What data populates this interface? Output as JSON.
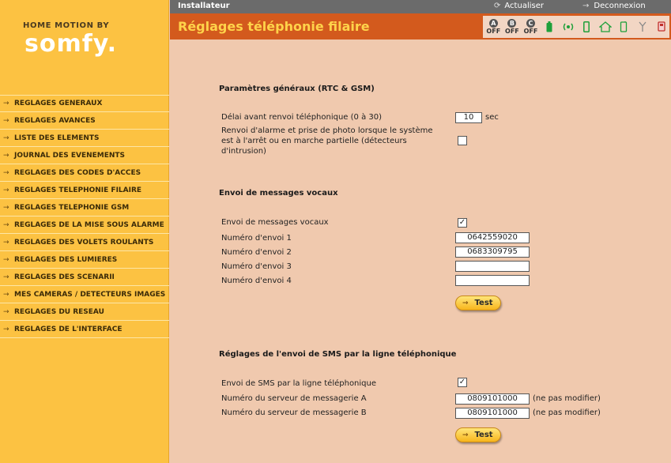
{
  "logo": {
    "tagline": "HOME MOTION BY",
    "brand": "somfy."
  },
  "sidebar": {
    "items": [
      {
        "label": "REGLAGES GENERAUX"
      },
      {
        "label": "REGLAGES AVANCES"
      },
      {
        "label": "LISTE DES ELEMENTS"
      },
      {
        "label": "JOURNAL DES EVENEMENTS"
      },
      {
        "label": "REGLAGES DES CODES D'ACCES"
      },
      {
        "label": "REGLAGES TELEPHONIE FILAIRE"
      },
      {
        "label": "REGLAGES TELEPHONIE GSM"
      },
      {
        "label": "REGLAGES DE LA MISE SOUS ALARME"
      },
      {
        "label": "REGLAGES DES VOLETS ROULANTS"
      },
      {
        "label": "REGLAGES DES LUMIERES"
      },
      {
        "label": "REGLAGES DES SCENARII"
      },
      {
        "label": "MES CAMERAS / DETECTEURS IMAGES"
      },
      {
        "label": "REGLAGES DU RESEAU"
      },
      {
        "label": "REGLAGES DE L'INTERFACE"
      }
    ]
  },
  "topbar": {
    "user": "Installateur",
    "refresh": "Actualiser",
    "logout": "Deconnexion"
  },
  "titlebar": {
    "title": "Réglages téléphonie filaire"
  },
  "status": {
    "zones": [
      {
        "letter": "A",
        "state": "OFF"
      },
      {
        "letter": "B",
        "state": "OFF"
      },
      {
        "letter": "C",
        "state": "OFF"
      }
    ],
    "icons": [
      "battery-icon",
      "signal-icon",
      "phone-icon",
      "home-ok-icon",
      "gsm-icon",
      "antenna-icon",
      "camera-icon"
    ],
    "colors": {
      "green": "#1ea03a",
      "red": "#c0302a"
    }
  },
  "general": {
    "title": "Paramètres généraux (RTC & GSM)",
    "delay_label": "Délai avant renvoi téléphonique (0 à 30)",
    "delay_value": "10",
    "delay_unit": "sec",
    "forward_label_1": "Renvoi d'alarme et prise de photo lorsque le système",
    "forward_label_2": "est à l'arrêt ou en marche partielle (détecteurs",
    "forward_label_3": "d'intrusion)",
    "forward_checked": false
  },
  "voice": {
    "title": "Envoi de messages vocaux",
    "enable_label": "Envoi de messages vocaux",
    "enable_checked": true,
    "numbers": [
      {
        "label": "Numéro d'envoi 1",
        "value": "0642559020"
      },
      {
        "label": "Numéro d'envoi 2",
        "value": "0683309795"
      },
      {
        "label": "Numéro d'envoi 3",
        "value": ""
      },
      {
        "label": "Numéro d'envoi 4",
        "value": ""
      }
    ],
    "test_label": "Test"
  },
  "sms": {
    "title": "Réglages de l'envoi de SMS par la ligne téléphonique",
    "enable_label": "Envoi de SMS par la ligne téléphonique",
    "enable_checked": true,
    "servers": [
      {
        "label": "Numéro du serveur de messagerie A",
        "value": "0809101000",
        "note": "(ne pas modifier)"
      },
      {
        "label": "Numéro du serveur de messagerie B",
        "value": "0809101000",
        "note": "(ne pas modifier)"
      }
    ],
    "test_label": "Test"
  }
}
